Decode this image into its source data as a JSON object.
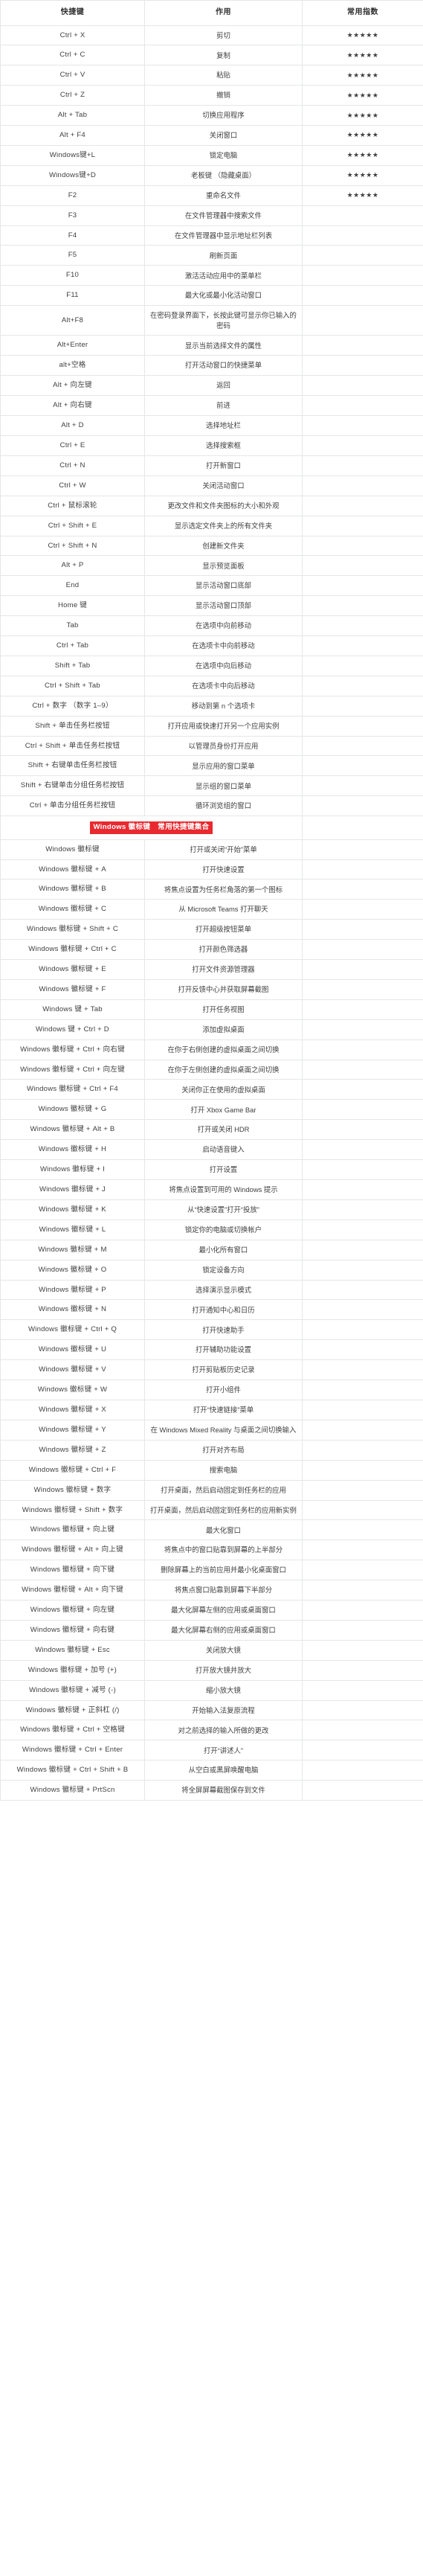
{
  "table": {
    "columns": [
      "快捷键",
      "作用",
      "常用指数"
    ],
    "star_symbol": "★★★★★",
    "section_label": "Windows 徽标键　常用快捷键集合",
    "section_color": "#e8292f",
    "rows": [
      {
        "key": "Ctrl + X",
        "action": "剪切",
        "index": "★★★★★"
      },
      {
        "key": "Ctrl + C",
        "action": "复制",
        "index": "★★★★★"
      },
      {
        "key": "Ctrl + V",
        "action": "粘贴",
        "index": "★★★★★"
      },
      {
        "key": "Ctrl + Z",
        "action": "撤销",
        "index": "★★★★★"
      },
      {
        "key": "Alt + Tab",
        "action": "切换应用程序",
        "index": "★★★★★"
      },
      {
        "key": "Alt + F4",
        "action": "关闭窗口",
        "index": "★★★★★"
      },
      {
        "key": "Windows键+L",
        "action": "锁定电脑",
        "index": "★★★★★"
      },
      {
        "key": "Windows键+D",
        "action": "老板键 （隐藏桌面）",
        "index": "★★★★★"
      },
      {
        "key": "F2",
        "action": "重命名文件",
        "index": "★★★★★"
      },
      {
        "key": "F3",
        "action": "在文件管理器中搜索文件",
        "index": ""
      },
      {
        "key": "F4",
        "action": "在文件管理器中显示地址栏列表",
        "index": ""
      },
      {
        "key": "F5",
        "action": "刷新页面",
        "index": ""
      },
      {
        "key": "F10",
        "action": "激活活动应用中的菜单栏",
        "index": ""
      },
      {
        "key": "F11",
        "action": "最大化或最小化活动窗口",
        "index": ""
      },
      {
        "key": "Alt+F8",
        "action": "在密码登录界面下，长按此键可显示你已输入的密码",
        "index": ""
      },
      {
        "key": "Alt+Enter",
        "action": "显示当前选择文件的属性",
        "index": ""
      },
      {
        "key": "alt+空格",
        "action": "打开活动窗口的快捷菜单",
        "index": ""
      },
      {
        "key": "Alt + 向左键",
        "action": "返回",
        "index": ""
      },
      {
        "key": "Alt + 向右键",
        "action": "前进",
        "index": ""
      },
      {
        "key": "Alt + D",
        "action": "选择地址栏",
        "index": ""
      },
      {
        "key": "Ctrl + E",
        "action": "选择搜索框",
        "index": ""
      },
      {
        "key": "Ctrl + N",
        "action": "打开新窗口",
        "index": ""
      },
      {
        "key": "Ctrl + W",
        "action": "关闭活动窗口",
        "index": ""
      },
      {
        "key": "Ctrl + 鼠标滚轮",
        "action": "更改文件和文件夹图标的大小和外观",
        "index": ""
      },
      {
        "key": "Ctrl + Shift + E",
        "action": "显示选定文件夹上的所有文件夹",
        "index": ""
      },
      {
        "key": "Ctrl + Shift + N",
        "action": "创建新文件夹",
        "index": ""
      },
      {
        "key": "Alt + P",
        "action": "显示预览面板",
        "index": ""
      },
      {
        "key": "End",
        "action": "显示活动窗口底部",
        "index": ""
      },
      {
        "key": "Home 键",
        "action": "显示活动窗口顶部",
        "index": ""
      },
      {
        "key": "Tab",
        "action": "在选项中向前移动",
        "index": ""
      },
      {
        "key": "Ctrl + Tab",
        "action": "在选项卡中向前移动",
        "index": ""
      },
      {
        "key": "Shift + Tab",
        "action": "在选项中向后移动",
        "index": ""
      },
      {
        "key": "Ctrl + Shift + Tab",
        "action": "在选项卡中向后移动",
        "index": ""
      },
      {
        "key": "Ctrl + 数字 （数字 1–9）",
        "action": "移动到第 n 个选项卡",
        "index": ""
      },
      {
        "key": "Shift + 单击任务栏按钮",
        "action": "打开应用或快速打开另一个应用实例",
        "index": ""
      },
      {
        "key": "Ctrl + Shift + 单击任务栏按钮",
        "action": "以管理员身份打开应用",
        "index": ""
      },
      {
        "key": "Shift + 右键单击任务栏按钮",
        "action": "显示应用的窗口菜单",
        "index": ""
      },
      {
        "key": "Shift + 右键单击分组任务栏按钮",
        "action": "显示组的窗口菜单",
        "index": ""
      },
      {
        "key": "Ctrl + 单击分组任务栏按钮",
        "action": "循环浏览组的窗口",
        "index": ""
      },
      {
        "key": "Windows 徽标键",
        "action": "打开或关闭“开始”菜单",
        "index": ""
      },
      {
        "key": "Windows 徽标键 + A",
        "action": "打开快速设置",
        "index": ""
      },
      {
        "key": "Windows 徽标键 + B",
        "action": "将焦点设置为任务栏角落的第一个图标",
        "index": ""
      },
      {
        "key": "Windows 徽标键 + C",
        "action": "从 Microsoft Teams 打开聊天",
        "index": ""
      },
      {
        "key": "Windows 徽标键 + Shift + C",
        "action": "打开超级按钮菜单",
        "index": ""
      },
      {
        "key": "Windows 徽标键 + Ctrl + C",
        "action": "打开颜色筛选器",
        "index": ""
      },
      {
        "key": "Windows 徽标键 + E",
        "action": "打开文件资源管理器",
        "index": ""
      },
      {
        "key": "Windows 徽标键 + F",
        "action": "打开反馈中心并获取屏幕截图",
        "index": ""
      },
      {
        "key": "Windows 键 + Tab",
        "action": "打开任务视图",
        "index": ""
      },
      {
        "key": "Windows 键 + Ctrl + D",
        "action": "添加虚拟桌面",
        "index": ""
      },
      {
        "key": "Windows 徽标键 + Ctrl + 向右键",
        "action": "在你于右侧创建的虚拟桌面之间切换",
        "index": ""
      },
      {
        "key": "Windows 徽标键 + Ctrl + 向左键",
        "action": "在你于左侧创建的虚拟桌面之间切换",
        "index": ""
      },
      {
        "key": "Windows 徽标键 + Ctrl + F4",
        "action": "关闭你正在使用的虚拟桌面",
        "index": ""
      },
      {
        "key": "Windows 徽标键 + G",
        "action": "打开 Xbox Game Bar",
        "index": ""
      },
      {
        "key": "Windows 徽标键 + Alt + B",
        "action": "打开或关闭 HDR",
        "index": ""
      },
      {
        "key": "Windows 徽标键 + H",
        "action": "启动语音键入",
        "index": ""
      },
      {
        "key": "Windows 徽标键 + I",
        "action": "打开设置",
        "index": ""
      },
      {
        "key": "Windows 徽标键 + J",
        "action": "将焦点设置到可用的 Windows 提示",
        "index": ""
      },
      {
        "key": "Windows 徽标键 + K",
        "action": "从“快速设置”打开“投放”",
        "index": ""
      },
      {
        "key": "Windows 徽标键 + L",
        "action": "锁定你的电脑或切换帐户",
        "index": ""
      },
      {
        "key": "Windows 徽标键 + M",
        "action": "最小化所有窗口",
        "index": ""
      },
      {
        "key": "Windows 徽标键 + O",
        "action": "锁定设备方向",
        "index": ""
      },
      {
        "key": "Windows 徽标键 + P",
        "action": "选择演示显示模式",
        "index": ""
      },
      {
        "key": "Windows 徽标键 + N",
        "action": "打开通知中心和日历",
        "index": ""
      },
      {
        "key": "Windows 徽标键 + Ctrl + Q",
        "action": "打开快速助手",
        "index": ""
      },
      {
        "key": "Windows 徽标键 + U",
        "action": "打开辅助功能设置",
        "index": ""
      },
      {
        "key": "Windows 徽标键 + V",
        "action": "打开剪贴板历史记录",
        "index": ""
      },
      {
        "key": "Windows 徽标键 + W",
        "action": "打开小组件",
        "index": ""
      },
      {
        "key": "Windows 徽标键 + X",
        "action": "打开“快速链接”菜单",
        "index": ""
      },
      {
        "key": "Windows 徽标键 + Y",
        "action": "在 Windows Mixed Reality 与桌面之间切换输入",
        "index": ""
      },
      {
        "key": "Windows 徽标键 + Z",
        "action": "打开对齐布局",
        "index": ""
      },
      {
        "key": "Windows 徽标键 + Ctrl + F",
        "action": "搜索电脑",
        "index": ""
      },
      {
        "key": "Windows 徽标键 + 数字",
        "action": "打开桌面，然后启动固定到任务栏的应用",
        "index": ""
      },
      {
        "key": "Windows 徽标键 + Shift + 数字",
        "action": "打开桌面，然后启动固定到任务栏的应用新实例",
        "index": ""
      },
      {
        "key": "Windows 徽标键 + 向上键",
        "action": "最大化窗口",
        "index": ""
      },
      {
        "key": "Windows 徽标键 + Alt + 向上键",
        "action": "将焦点中的窗口贴靠到屏幕的上半部分",
        "index": ""
      },
      {
        "key": "Windows 徽标键 + 向下键",
        "action": "删除屏幕上的当前应用并最小化桌面窗口",
        "index": ""
      },
      {
        "key": "Windows 徽标键 + Alt + 向下键",
        "action": "将焦点窗口贴靠到屏幕下半部分",
        "index": ""
      },
      {
        "key": "Windows 徽标键 + 向左键",
        "action": "最大化屏幕左侧的应用或桌面窗口",
        "index": ""
      },
      {
        "key": "Windows 徽标键 + 向右键",
        "action": "最大化屏幕右侧的应用或桌面窗口",
        "index": ""
      },
      {
        "key": "Windows 徽标键 + Esc",
        "action": "关闭放大镜",
        "index": ""
      },
      {
        "key": "Windows 徽标键 + 加号 (+)",
        "action": "打开放大镜并放大",
        "index": ""
      },
      {
        "key": "Windows 徽标键 + 减号 (-)",
        "action": "缩小放大镜",
        "index": ""
      },
      {
        "key": "Windows 徽标键 + 正斜杠 (/)",
        "action": "开始输入法复原流程",
        "index": ""
      },
      {
        "key": "Windows 徽标键 + Ctrl + 空格键",
        "action": "对之前选择的输入所做的更改",
        "index": ""
      },
      {
        "key": "Windows 徽标键 + Ctrl + Enter",
        "action": "打开“讲述人”",
        "index": ""
      },
      {
        "key": "Windows 徽标键 + Ctrl + Shift + B",
        "action": "从空白或黑屏唤醒电脑",
        "index": ""
      },
      {
        "key": "Windows 徽标键 + PrtScn",
        "action": "将全屏屏幕截图保存到文件",
        "index": ""
      }
    ],
    "section_after_index": 38
  }
}
